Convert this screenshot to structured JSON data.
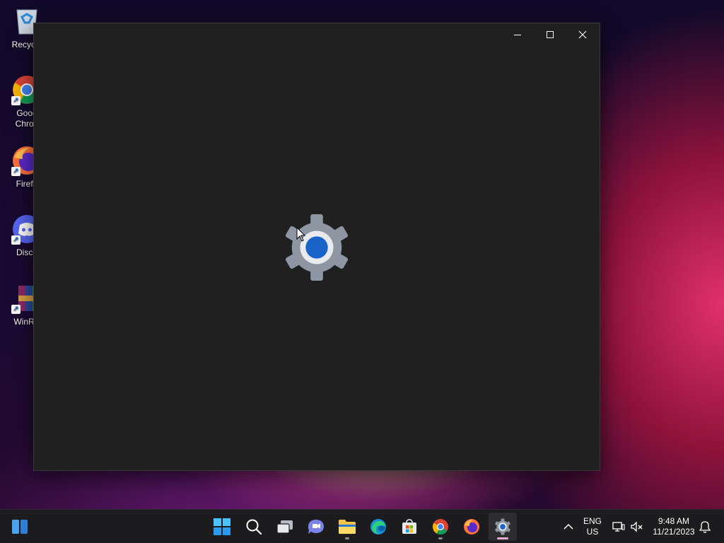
{
  "desktop": {
    "icons": [
      {
        "name": "recycle-bin",
        "label": "Recycle"
      },
      {
        "name": "google-chrome",
        "label": "Goog\nChron"
      },
      {
        "name": "firefox",
        "label": "Firefo"
      },
      {
        "name": "discord",
        "label": "Disco"
      },
      {
        "name": "winrar",
        "label": "WinRA"
      }
    ]
  },
  "window": {
    "app_icon": "settings-gear-icon",
    "controls": {
      "minimize_icon": "minimize-icon",
      "maximize_icon": "maximize-icon",
      "close_icon": "close-icon"
    }
  },
  "taskbar": {
    "widgets_icon": "widgets-icon",
    "pinned": [
      {
        "name": "start",
        "icon": "windows-logo-icon"
      },
      {
        "name": "search",
        "icon": "search-icon"
      },
      {
        "name": "task-view",
        "icon": "task-view-icon"
      },
      {
        "name": "chat",
        "icon": "chat-icon"
      },
      {
        "name": "file-explorer",
        "icon": "folder-icon",
        "running": true
      },
      {
        "name": "edge",
        "icon": "edge-icon"
      },
      {
        "name": "store",
        "icon": "store-icon"
      },
      {
        "name": "chrome",
        "icon": "chrome-icon",
        "running": true
      },
      {
        "name": "firefox",
        "icon": "firefox-icon"
      },
      {
        "name": "settings",
        "icon": "settings-gear-icon",
        "running": true,
        "active": true
      }
    ],
    "tray": {
      "overflow_icon": "chevron-up-icon",
      "language": {
        "line1": "ENG",
        "line2": "US"
      },
      "network_icon": "network-icon",
      "volume_icon": "volume-muted-icon",
      "clock": {
        "time": "9:48 AM",
        "date": "11/21/2023"
      },
      "notification_icon": "notification-bell-icon"
    }
  },
  "colors": {
    "accent": "#1a64c8",
    "window_bg": "#202020",
    "taskbar_bg": "#1c1c1e"
  }
}
